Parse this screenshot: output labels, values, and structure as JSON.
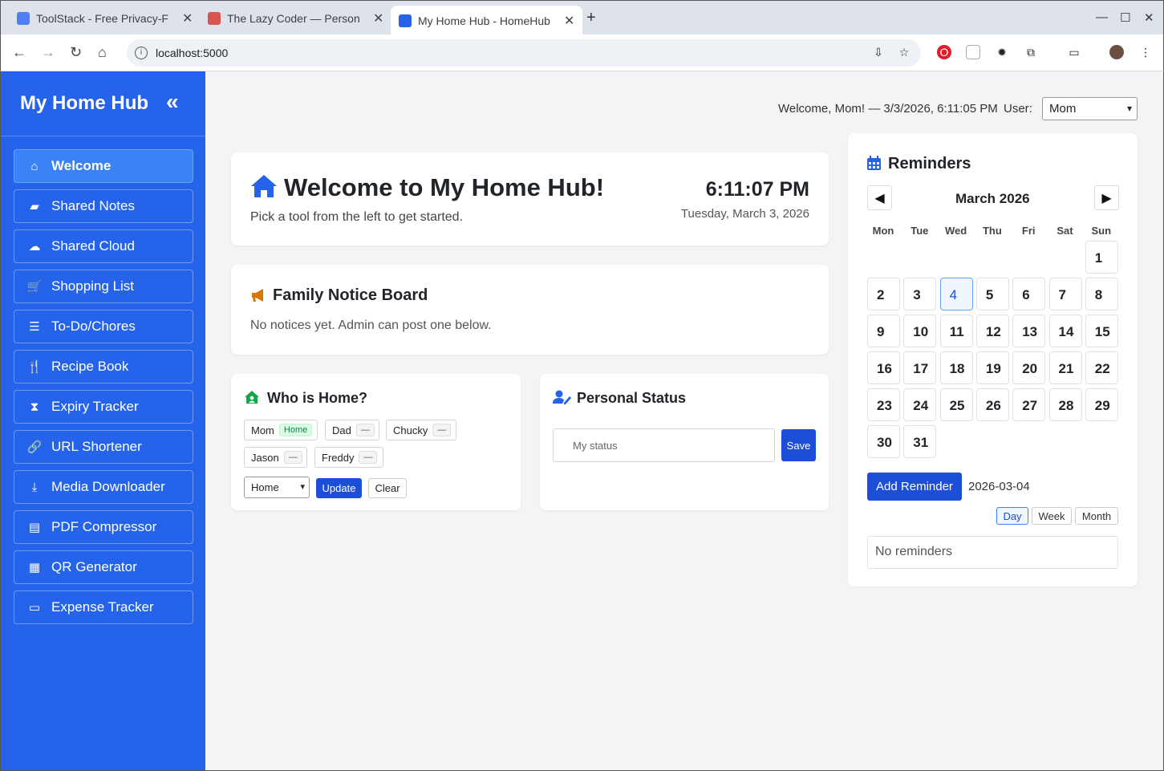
{
  "browser": {
    "tabs": [
      {
        "title": "ToolStack - Free Privacy-F",
        "favicon_color": "#4f7df3"
      },
      {
        "title": "The Lazy Coder — Person",
        "favicon_color": "#d9534f"
      },
      {
        "title": "My Home Hub - HomeHub",
        "favicon_color": "#2563eb"
      }
    ],
    "url": "localhost:5000"
  },
  "sidebar": {
    "brand": "My Home Hub",
    "collapse_icon": "«",
    "items": [
      {
        "label": "Welcome",
        "icon": "home-icon",
        "glyph": "⌂",
        "active": true
      },
      {
        "label": "Shared Notes",
        "icon": "note-icon",
        "glyph": "▰"
      },
      {
        "label": "Shared Cloud",
        "icon": "cloud-icon",
        "glyph": "☁"
      },
      {
        "label": "Shopping List",
        "icon": "cart-icon",
        "glyph": "🛒"
      },
      {
        "label": "To-Do/Chores",
        "icon": "list-check-icon",
        "glyph": "☰"
      },
      {
        "label": "Recipe Book",
        "icon": "utensils-icon",
        "glyph": "🍴"
      },
      {
        "label": "Expiry Tracker",
        "icon": "hourglass-icon",
        "glyph": "⧗"
      },
      {
        "label": "URL Shortener",
        "icon": "link-icon",
        "glyph": "🔗"
      },
      {
        "label": "Media Downloader",
        "icon": "download-icon",
        "glyph": "⤓"
      },
      {
        "label": "PDF Compressor",
        "icon": "pdf-icon",
        "glyph": "▤"
      },
      {
        "label": "QR Generator",
        "icon": "qrcode-icon",
        "glyph": "▦"
      },
      {
        "label": "Expense Tracker",
        "icon": "wallet-icon",
        "glyph": "▭"
      }
    ]
  },
  "header": {
    "welcome_text": "Welcome, Mom! — 3/3/2026, 6:11:05 PM",
    "user_label": "User:",
    "user_selected": "Mom"
  },
  "welcome_card": {
    "title": "Welcome to My Home Hub!",
    "subtitle": "Pick a tool from the left to get started.",
    "time": "6:11:07 PM",
    "date": "Tuesday, March 3, 2026"
  },
  "notice_board": {
    "title": "Family Notice Board",
    "text": "No notices yet. Admin can post one below."
  },
  "who_is_home": {
    "title": "Who is Home?",
    "members": [
      {
        "name": "Mom",
        "status": "Home"
      },
      {
        "name": "Dad",
        "status": "—"
      },
      {
        "name": "Chucky",
        "status": "—"
      },
      {
        "name": "Jason",
        "status": "—"
      },
      {
        "name": "Freddy",
        "status": "—"
      }
    ],
    "select_value": "Home",
    "update_label": "Update",
    "clear_label": "Clear"
  },
  "personal_status": {
    "title": "Personal Status",
    "placeholder": "My status",
    "save_label": "Save"
  },
  "reminders": {
    "title": "Reminders",
    "month": "March 2026",
    "weekdays": [
      "Mon",
      "Tue",
      "Wed",
      "Thu",
      "Fri",
      "Sat",
      "Sun"
    ],
    "days": [
      "1",
      "2",
      "3",
      "4",
      "5",
      "6",
      "7",
      "8",
      "9",
      "10",
      "11",
      "12",
      "13",
      "14",
      "15",
      "16",
      "17",
      "18",
      "19",
      "20",
      "21",
      "22",
      "23",
      "24",
      "25",
      "26",
      "27",
      "28",
      "29",
      "30",
      "31"
    ],
    "selected_day": "4",
    "add_label": "Add Reminder",
    "selected_date": "2026-03-04",
    "views": [
      "Day",
      "Week",
      "Month"
    ],
    "active_view": "Day",
    "empty_text": "No reminders"
  }
}
